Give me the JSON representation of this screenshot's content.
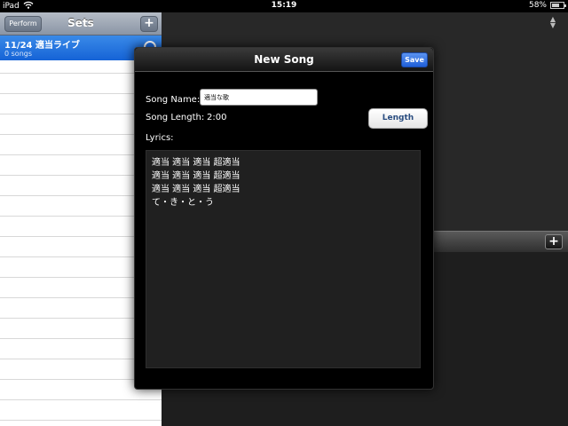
{
  "status_bar": {
    "device": "iPad",
    "time": "15:19",
    "battery": "58%"
  },
  "left_pane": {
    "nav": {
      "left_button": "Perform",
      "title": "Sets",
      "right_button": "+"
    },
    "selected_row": {
      "title": "11/24 適当ライブ",
      "subtitle": "0 songs"
    }
  },
  "right_pane": {
    "toolbar_button": "+"
  },
  "modal": {
    "title": "New Song",
    "save_label": "Save",
    "song_name_label": "Song Name:",
    "song_name_value": "適当な歌",
    "song_length_label": "Song Length:",
    "song_length_value": "2:00",
    "length_button": "Length",
    "lyrics_label": "Lyrics:",
    "lyrics_lines": [
      "適当 適当 適当 超適当",
      "適当 適当 適当 超適当",
      "適当 適当 適当 超適当",
      "て・き・と・う"
    ]
  },
  "colors": {
    "accent_blue": "#1f6ee0",
    "save_blue": "#3a7ae6",
    "modal_bg": "#000000"
  },
  "icons": {
    "wifi": "wifi-icon",
    "battery": "battery-icon",
    "sort": "sort-arrows-icon",
    "disclosure": "disclosure-icon"
  }
}
